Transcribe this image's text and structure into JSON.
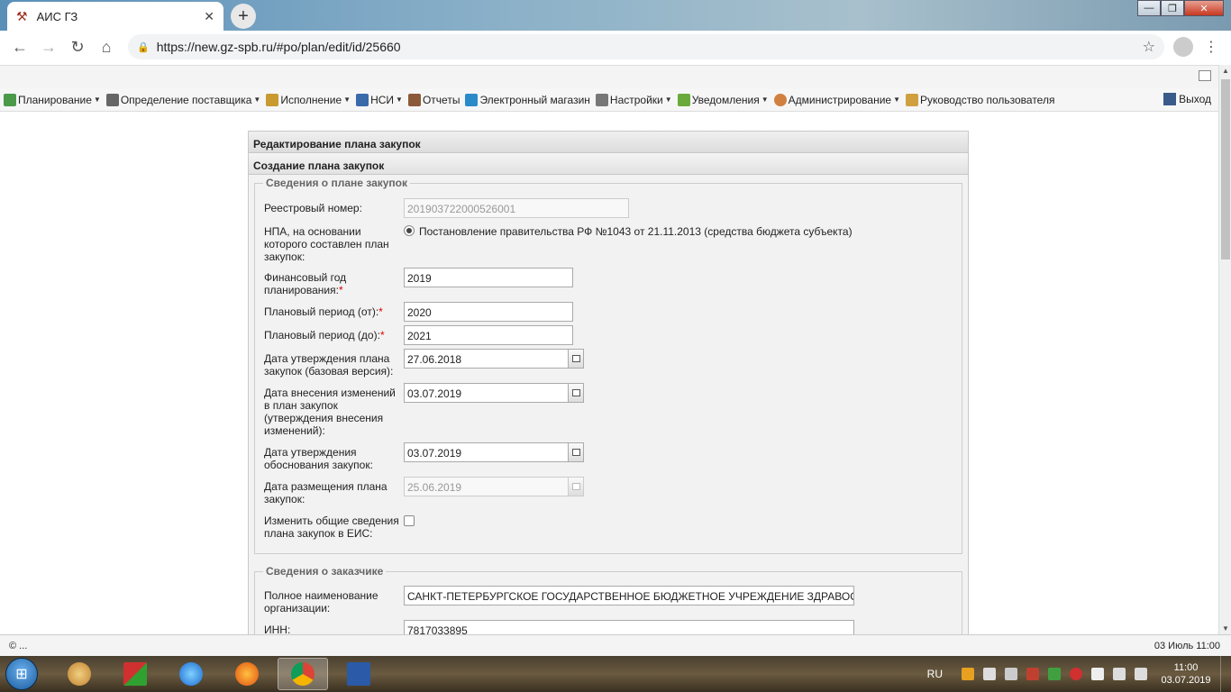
{
  "browser": {
    "tab_title": "АИС ГЗ",
    "tab_close": "✕",
    "new_tab": "+",
    "url": "https://new.gz-spb.ru/#po/plan/edit/id/25660",
    "window_minimize": "—",
    "window_restore": "❐",
    "window_close": "✕"
  },
  "menu": {
    "items": [
      {
        "label": "Планирование",
        "dropdown": true,
        "icon": "planning-icon",
        "color": "#4a9a4a"
      },
      {
        "label": "Определение поставщика",
        "dropdown": true,
        "icon": "gears-icon",
        "color": "#666666"
      },
      {
        "label": "Исполнение",
        "dropdown": true,
        "icon": "execution-icon",
        "color": "#c89a30"
      },
      {
        "label": "НСИ",
        "dropdown": true,
        "icon": "book-icon",
        "color": "#3a6aaa"
      },
      {
        "label": "Отчеты",
        "dropdown": false,
        "icon": "report-icon",
        "color": "#8a5a3a"
      },
      {
        "label": "Электронный магазин",
        "dropdown": false,
        "icon": "cart-icon",
        "color": "#2a8aca"
      },
      {
        "label": "Настройки",
        "dropdown": true,
        "icon": "wrench-icon",
        "color": "#777777"
      },
      {
        "label": "Уведомления",
        "dropdown": true,
        "icon": "notification-icon",
        "color": "#6aaa3a"
      },
      {
        "label": "Администрирование",
        "dropdown": true,
        "icon": "user-icon",
        "color": "#d08040"
      },
      {
        "label": "Руководство пользователя",
        "dropdown": false,
        "icon": "manual-icon",
        "color": "#d0a040"
      }
    ],
    "exit_label": "Выход"
  },
  "panel": {
    "title": "Редактирование плана закупок",
    "subtitle": "Создание плана закупок",
    "plan_section": {
      "legend": "Сведения о плане закупок",
      "registry_label": "Реестровый номер:",
      "registry_value": "201903722000526001",
      "npa_label": "НПА, на основании которого составлен план закупок:",
      "npa_option": "Постановление правительства РФ №1043 от 21.11.2013 (средства бюджета субъекта)",
      "fin_year_label": "Финансовый год планирования:",
      "fin_year_value": "2019",
      "period_from_label": "Плановый период (от):",
      "period_from_value": "2020",
      "period_to_label": "Плановый период (до):",
      "period_to_value": "2021",
      "approve_date_label": "Дата утверждения плана закупок (базовая версия):",
      "approve_date_value": "27.06.2018",
      "change_date_label": "Дата внесения изменений в план закупок (утверждения внесения изменений):",
      "change_date_value": "03.07.2019",
      "justify_date_label": "Дата утверждения обоснования закупок:",
      "justify_date_value": "03.07.2019",
      "publish_date_label": "Дата размещения плана закупок:",
      "publish_date_value": "25.06.2019",
      "change_eis_label": "Изменить общие сведения плана закупок в ЕИС:"
    },
    "customer_section": {
      "legend": "Сведения о заказчике",
      "org_name_label": "Полное наименование организации:",
      "org_name_value": "САНКТ-ПЕТЕРБУРГСКОЕ ГОСУДАРСТВЕННОЕ БЮДЖЕТНОЕ УЧРЕЖДЕНИЕ ЗДРАВООХРАНЕНИЯ",
      "inn_label": "ИНН:",
      "inn_value": "7817033895"
    },
    "required_mark": "*"
  },
  "status": {
    "left": "© ...",
    "right": "03 Июль 11:00"
  },
  "taskbar": {
    "lang": "RU",
    "time": "11:00",
    "date": "03.07.2019"
  }
}
